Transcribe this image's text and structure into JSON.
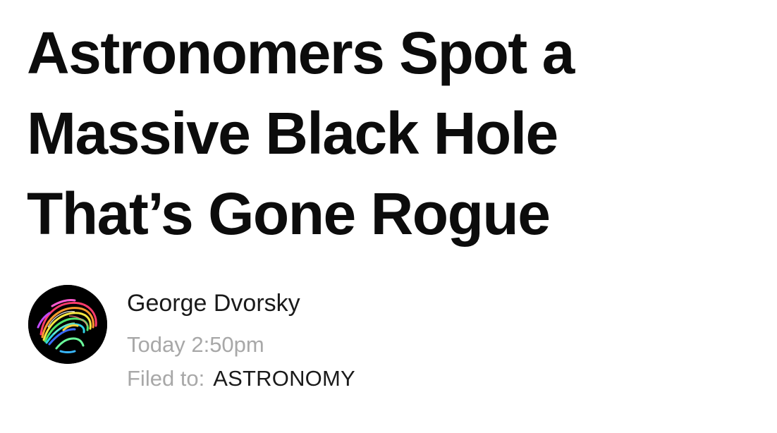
{
  "article": {
    "headline_lines": [
      "Astronomers Spot a",
      "Massive Black Hole",
      "That’s Gone Rogue"
    ],
    "author": "George Dvorsky",
    "timestamp": "Today 2:50pm",
    "filed_label": "Filed to:",
    "filed_tag": "ASTRONOMY"
  },
  "colors": {
    "headline": "#0c0c0c",
    "author": "#1a1a1a",
    "meta_muted": "#a8a8a8",
    "avatar_bg": "#000000"
  },
  "icons": {
    "avatar": "brain-tractography-avatar"
  }
}
